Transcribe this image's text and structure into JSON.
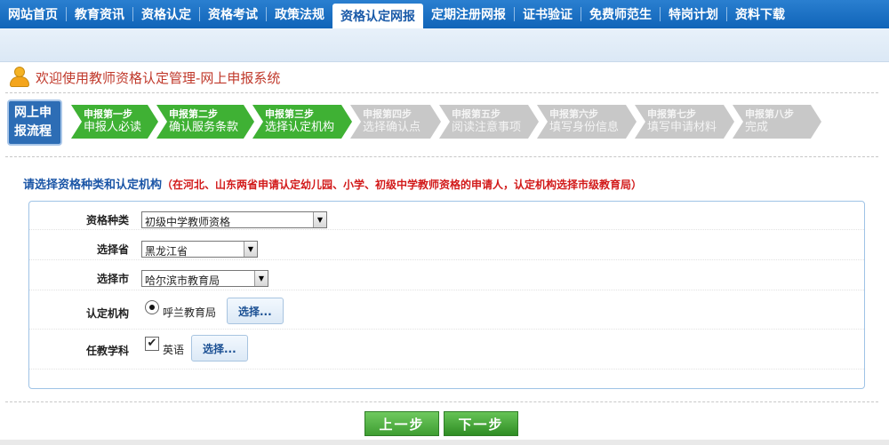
{
  "nav": {
    "items": [
      {
        "label": "网站首页",
        "active": false
      },
      {
        "label": "教育资讯",
        "active": false
      },
      {
        "label": "资格认定",
        "active": false
      },
      {
        "label": "资格考试",
        "active": false
      },
      {
        "label": "政策法规",
        "active": false
      },
      {
        "label": "资格认定网报",
        "active": true
      },
      {
        "label": "定期注册网报",
        "active": false
      },
      {
        "label": "证书验证",
        "active": false
      },
      {
        "label": "免费师范生",
        "active": false
      },
      {
        "label": "特岗计划",
        "active": false
      },
      {
        "label": "资料下载",
        "active": false
      }
    ]
  },
  "welcome": {
    "text": "欢迎使用教师资格认定管理-网上申报系统"
  },
  "flow": {
    "badge_line1": "网上申",
    "badge_line2": "报流程",
    "steps": [
      {
        "step": "申报第一步",
        "name": "申报人必读",
        "done": true
      },
      {
        "step": "申报第二步",
        "name": "确认服务条款",
        "done": true
      },
      {
        "step": "申报第三步",
        "name": "选择认定机构",
        "done": true
      },
      {
        "step": "申报第四步",
        "name": "选择确认点",
        "done": false
      },
      {
        "step": "申报第五步",
        "name": "阅读注意事项",
        "done": false
      },
      {
        "step": "申报第六步",
        "name": "填写身份信息",
        "done": false
      },
      {
        "step": "申报第七步",
        "name": "填写申请材料",
        "done": false
      },
      {
        "step": "申报第八步",
        "name": "完成",
        "done": false
      }
    ]
  },
  "section": {
    "title": "请选择资格种类和认定机构",
    "note": "（在河北、山东两省申请认定幼儿园、小学、初级中学教师资格的申请人，认定机构选择市级教育局）"
  },
  "form": {
    "qual_type": {
      "label": "资格种类",
      "value": "初级中学教师资格"
    },
    "province": {
      "label": "选择省",
      "value": "黑龙江省"
    },
    "city": {
      "label": "选择市",
      "value": "哈尔滨市教育局"
    },
    "agency": {
      "label": "认定机构",
      "value": "呼兰教育局",
      "button": "选择..."
    },
    "subject": {
      "label": "任教学科",
      "value": "英语",
      "button": "选择..."
    }
  },
  "buttons": {
    "prev": "上一步",
    "next": "下一步"
  },
  "colors": {
    "nav": "#1a6fc4",
    "step_done": "#3fb134",
    "step_todo": "#c8c8c8",
    "title_blue": "#1a55a6",
    "note_red": "#d21a1a"
  }
}
